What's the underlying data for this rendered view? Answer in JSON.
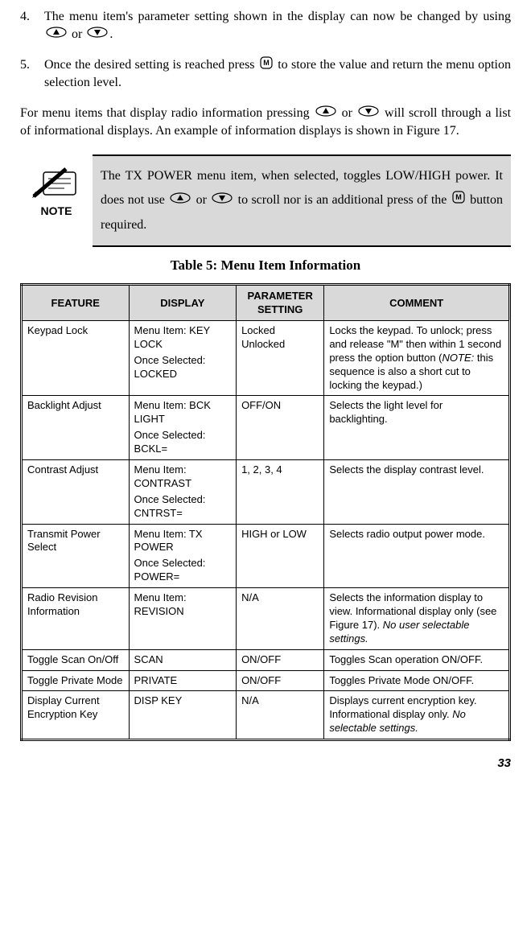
{
  "step4": {
    "num": "4.",
    "text_a": "The menu item's parameter setting shown in the display can now be changed by using ",
    "text_b": " or ",
    "text_c": "."
  },
  "step5": {
    "num": "5.",
    "text_a": "Once the desired setting is reached press ",
    "text_b": " to store the value and return the menu option selection level."
  },
  "para_radio": {
    "a": "For menu items that display radio information pressing ",
    "b": " or ",
    "c": " will scroll through a list of informational displays. An example of information displays is shown in Figure 17."
  },
  "note": {
    "label": "NOTE",
    "a": "The TX POWER menu item, when selected, toggles LOW/HIGH power. It does not use ",
    "b": " or ",
    "c": " to scroll nor is an additional press of the ",
    "d": " button required."
  },
  "table_title": "Table 5:  Menu Item Information",
  "headers": {
    "feature": "FEATURE",
    "display": "DISPLAY",
    "parameter": "PARAMETER SETTING",
    "comment": "COMMENT"
  },
  "rows": [
    {
      "feature": "Keypad Lock",
      "display_a": "Menu Item: KEY LOCK",
      "display_b": "Once Selected: LOCKED",
      "param": "Locked Unlocked",
      "comment_a": "Locks the keypad.  To unlock; press and release \"M\" then within 1 second press the option button (",
      "comment_note": "NOTE:",
      "comment_b": "  this sequence is also a short cut to locking the keypad.)"
    },
    {
      "feature": "Backlight Adjust",
      "display_a": "Menu Item: BCK LIGHT",
      "display_b": "Once Selected: BCKL=",
      "param": "OFF/ON",
      "comment": "Selects the light level for backlighting."
    },
    {
      "feature": "Contrast Adjust",
      "display_a": "Menu Item: CONTRAST",
      "display_b": "Once Selected: CNTRST=",
      "param": "1, 2, 3, 4",
      "comment": "Selects the display contrast level."
    },
    {
      "feature": "Transmit Power Select",
      "display_a": "Menu Item: TX POWER",
      "display_b": "Once Selected: POWER=",
      "param": "HIGH or LOW",
      "comment": "Selects radio output power mode."
    },
    {
      "feature": "Radio Revision Information",
      "display_a": "Menu Item: REVISION",
      "display_b": "",
      "param": "N/A",
      "comment_a": "Selects the information display to view.  Informational display only (see Figure 17).  ",
      "comment_it": "No user selectable settings."
    },
    {
      "feature": "Toggle Scan On/Off",
      "display_a": "SCAN",
      "display_b": "",
      "param": "ON/OFF",
      "comment": "Toggles Scan operation ON/OFF."
    },
    {
      "feature": "Toggle Private Mode",
      "display_a": "PRIVATE",
      "display_b": "",
      "param": "ON/OFF",
      "comment": "Toggles Private Mode ON/OFF."
    },
    {
      "feature": "Display Current Encryption Key",
      "display_a": "DISP KEY",
      "display_b": "",
      "param": "N/A",
      "comment_a": "Displays current encryption key.  Informational display only. ",
      "comment_it": "No selectable settings."
    }
  ],
  "page_number": "33"
}
